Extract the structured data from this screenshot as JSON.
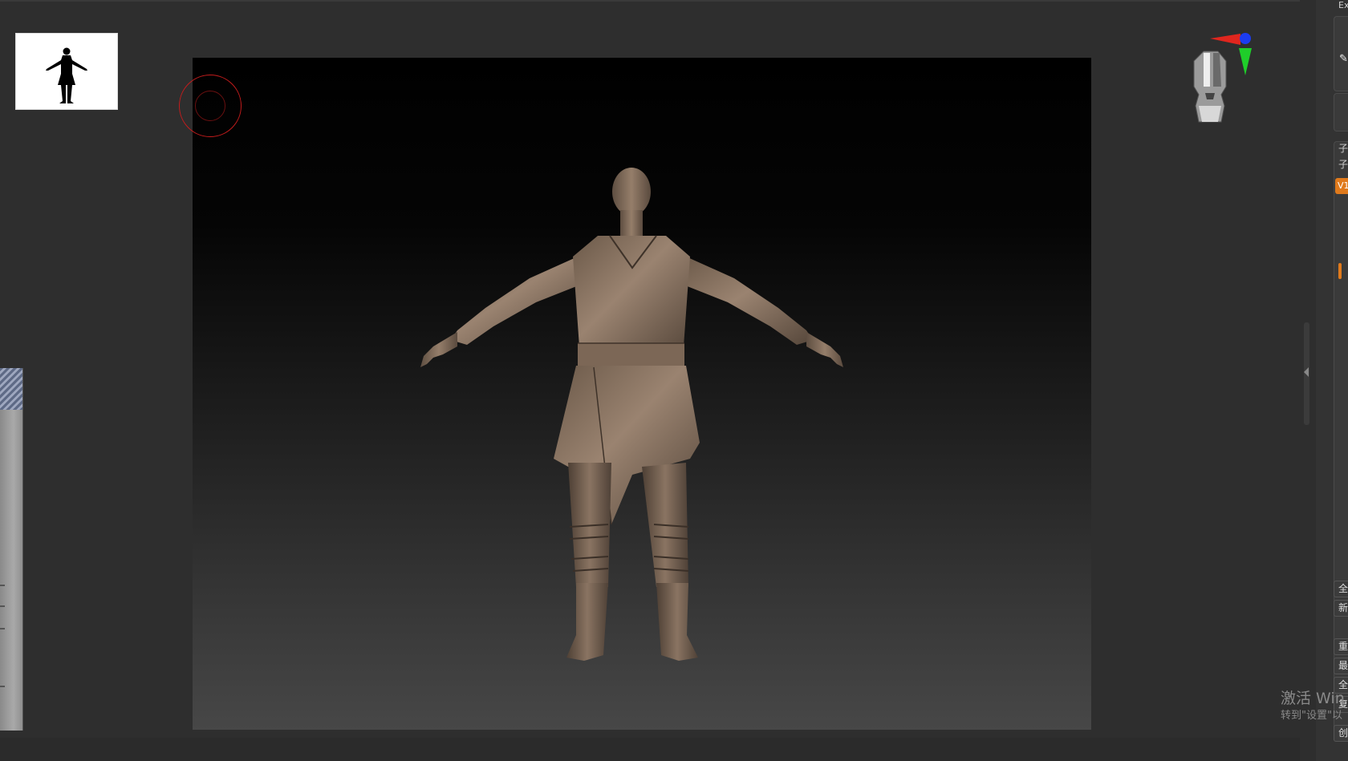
{
  "right_panel": {
    "top_label": "Ex",
    "icon": "pen-icon",
    "section_label": "子",
    "section_sub": "子",
    "version_badge": "V1",
    "buttons": [
      "全",
      "新",
      "重",
      "最",
      "全",
      "复",
      "创"
    ]
  },
  "watermark": {
    "line1": "激活 Win",
    "line2": "转到\"设置\"以"
  },
  "colors": {
    "accent": "#e07a1c",
    "brush_ring": "#c41c1c",
    "gizmo_x": "#e0261e",
    "gizmo_y": "#1fce2a",
    "gizmo_z": "#1c3cf0",
    "model": "#7f6b59"
  }
}
